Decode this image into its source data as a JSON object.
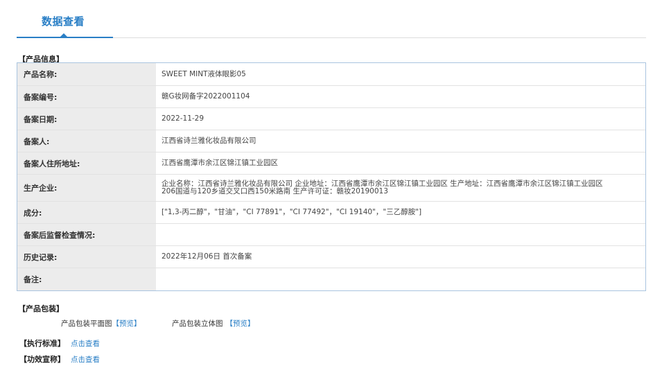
{
  "tab": {
    "label": "数据查看"
  },
  "product_info": {
    "section_title": "【产品信息】",
    "rows": [
      {
        "label": "产品名称:",
        "value": "SWEET MINT液体眼影05"
      },
      {
        "label": "备案编号:",
        "value": "赣G妆网备字2022001104"
      },
      {
        "label": "备案日期:",
        "value": "2022-11-29"
      },
      {
        "label": "备案人:",
        "value": "江西省诗兰雅化妆品有限公司"
      },
      {
        "label": "备案人住所地址:",
        "value": "江西省鹰潭市余江区锦江镇工业园区"
      },
      {
        "label": "生产企业:",
        "value": "企业名称：江西省诗兰雅化妆品有限公司 企业地址：江西省鹰潭市余江区锦江镇工业园区 生产地址：江西省鹰潭市余江区锦江镇工业园区\n206国道与120乡道交叉口西150米路南 生产许可证：赣妆20190013"
      },
      {
        "label": "成分:",
        "value": "[\"1,3-丙二醇\"，\"甘油\"，\"CI 77891\"，\"CI 77492\"，\"CI 19140\"，\"三乙醇胺\"]"
      },
      {
        "label": "备案后监督检查情况:",
        "value": ""
      },
      {
        "label": "历史记录:",
        "value": "2022年12月06日 首次备案"
      },
      {
        "label": "备注:",
        "value": ""
      }
    ]
  },
  "packaging": {
    "section_title": "【产品包装】",
    "flat_label": "产品包装平面图",
    "flat_preview": "【预览】",
    "stereo_label": "产品包装立体图",
    "stereo_preview": "【预览】"
  },
  "standard": {
    "section_title": "【执行标准】",
    "link": "点击查看"
  },
  "efficacy": {
    "section_title": "【功效宣称】",
    "link": "点击查看"
  }
}
